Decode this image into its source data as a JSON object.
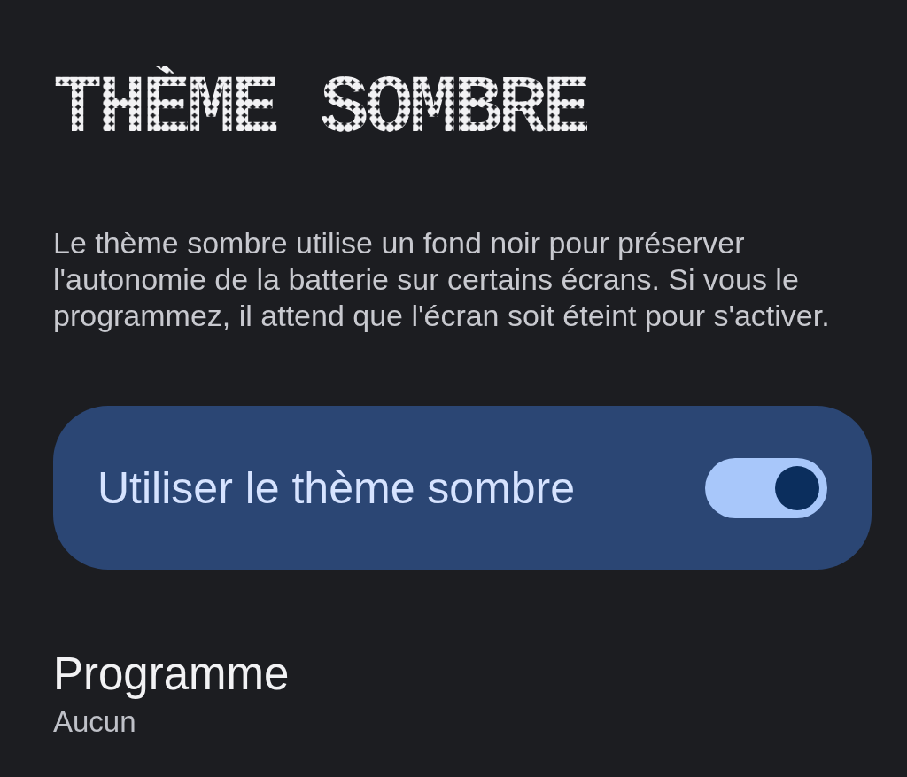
{
  "title": "THÈME SOMBRE",
  "description": "Le thème sombre utilise un fond noir pour préserver l'autonomie de la batterie sur certains écrans. Si vous le programmez, il attend que l'écran soit éteint pour s'activer.",
  "toggle": {
    "label": "Utiliser le thème sombre",
    "on": true
  },
  "schedule": {
    "label": "Programme",
    "value": "Aucun"
  }
}
